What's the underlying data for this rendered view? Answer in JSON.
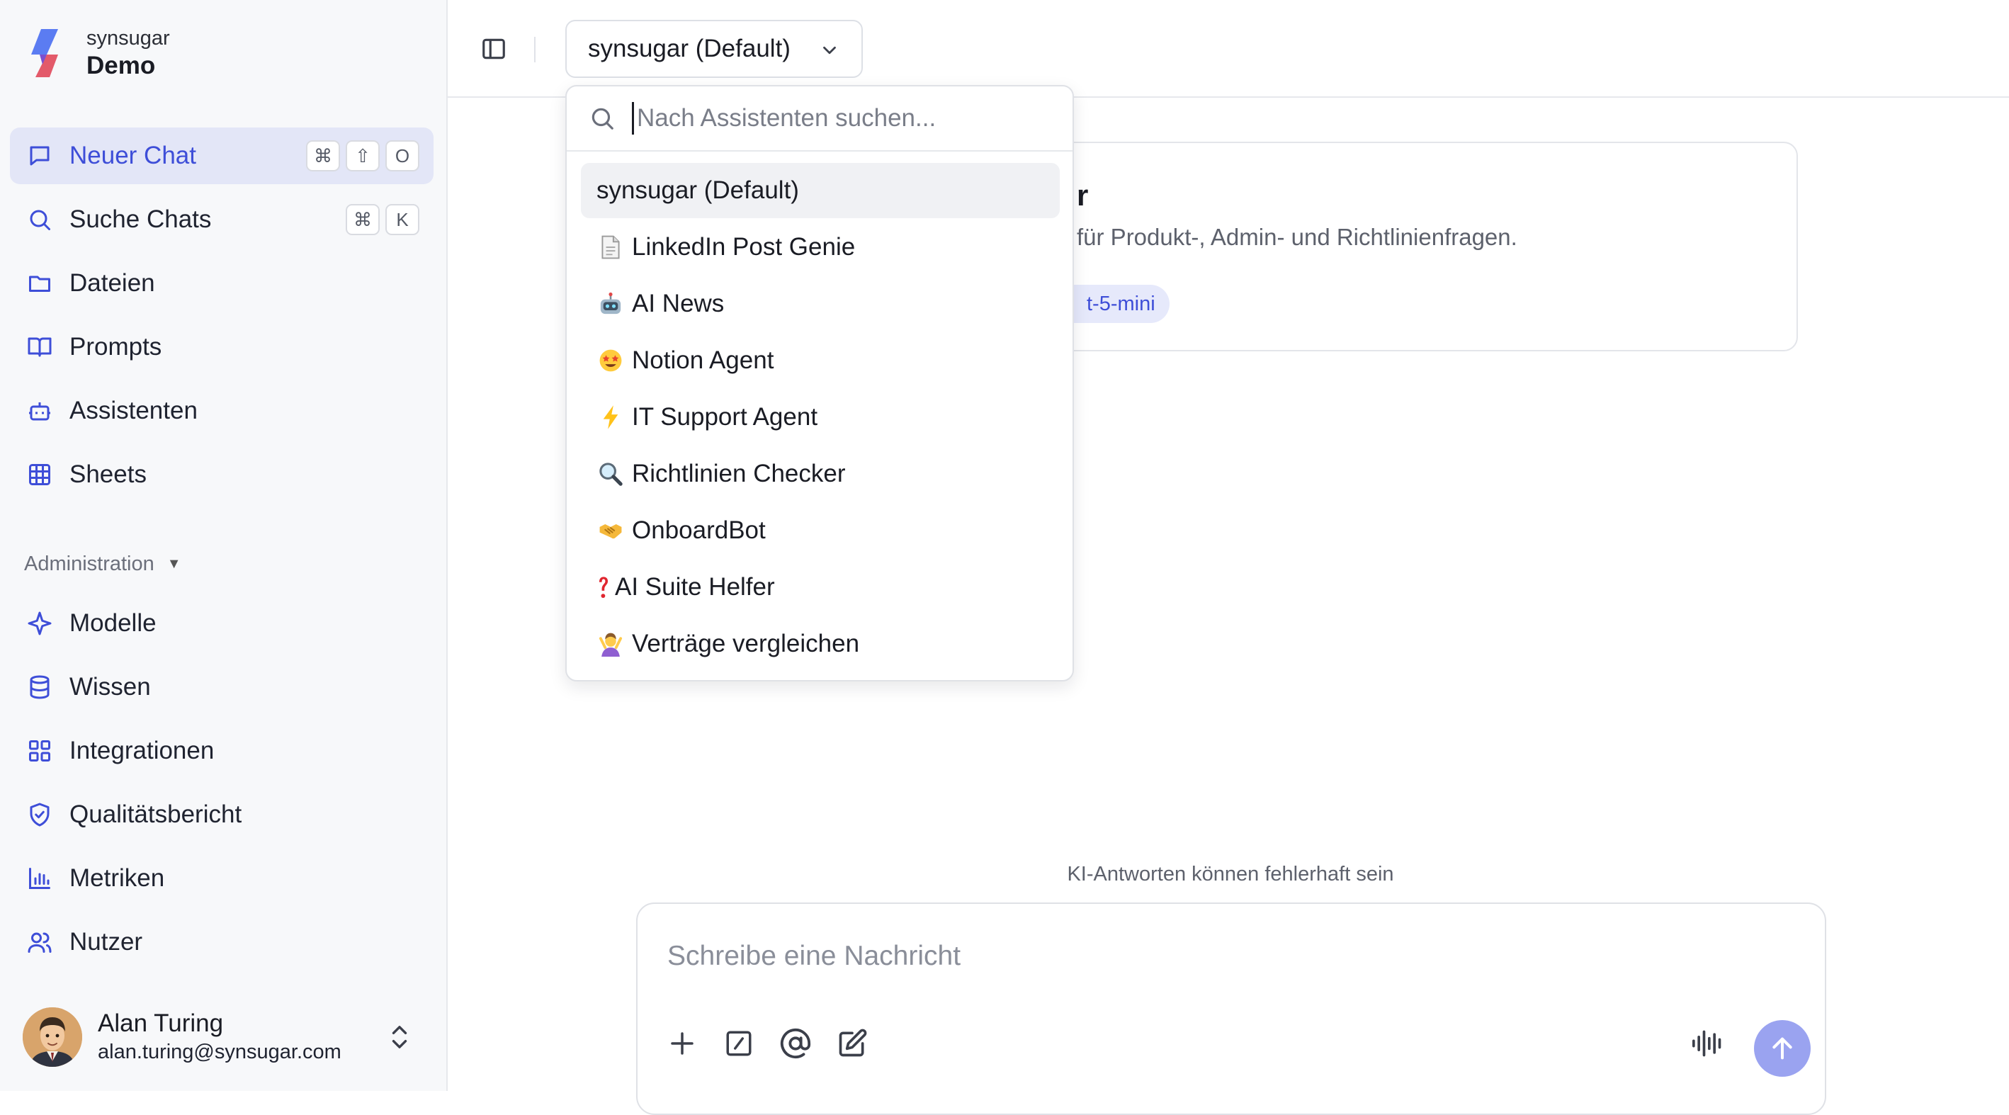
{
  "brand": {
    "org": "synsugar",
    "workspace": "Demo",
    "logo_icon": "synsugar-logo"
  },
  "sidebar": {
    "items": [
      {
        "label": "Neuer Chat",
        "icon": "chat-bubble-icon",
        "shortcut": [
          "⌘",
          "⇧",
          "O"
        ],
        "active": true
      },
      {
        "label": "Suche Chats",
        "icon": "search-icon",
        "shortcut": [
          "⌘",
          "K"
        ]
      },
      {
        "label": "Dateien",
        "icon": "folder-icon"
      },
      {
        "label": "Prompts",
        "icon": "book-icon"
      },
      {
        "label": "Assistenten",
        "icon": "bot-icon"
      },
      {
        "label": "Sheets",
        "icon": "table-icon"
      }
    ],
    "admin_label": "Administration",
    "admin_items": [
      {
        "label": "Modelle",
        "icon": "sparkle-icon"
      },
      {
        "label": "Wissen",
        "icon": "database-icon"
      },
      {
        "label": "Integrationen",
        "icon": "grid-icon"
      },
      {
        "label": "Qualitätsbericht",
        "icon": "shield-check-icon"
      },
      {
        "label": "Metriken",
        "icon": "bar-chart-icon"
      },
      {
        "label": "Nutzer",
        "icon": "users-icon"
      }
    ]
  },
  "user": {
    "name": "Alan Turing",
    "email": "alan.turing@synsugar.com"
  },
  "topbar": {
    "assistant_selected": "synsugar (Default)"
  },
  "dropdown": {
    "search_placeholder": "Nach Assistenten suchen...",
    "items": [
      {
        "emoji": "",
        "label": "synsugar (Default)",
        "selected": true
      },
      {
        "emoji": "📄",
        "label": "LinkedIn Post Genie"
      },
      {
        "emoji": "🤖",
        "label": "AI News"
      },
      {
        "emoji": "🤩",
        "label": "Notion Agent"
      },
      {
        "emoji": "⚡",
        "label": "IT Support Agent"
      },
      {
        "emoji": "🔍",
        "label": "Richtlinien Checker"
      },
      {
        "emoji": "🤝",
        "label": "OnboardBot"
      },
      {
        "emoji": "❓",
        "label": "AI Suite Helfer"
      },
      {
        "emoji": "🙆",
        "label": "Verträge vergleichen"
      }
    ]
  },
  "card": {
    "title_partial": "r",
    "description_partial": "für Produkt-, Admin- und Richtlinienfragen.",
    "badge_partial": "t-5-mini"
  },
  "composer": {
    "disclaimer": "KI-Antworten können fehlerhaft sein",
    "placeholder": "Schreibe eine Nachricht",
    "tools": [
      "plus-icon",
      "slash-command-icon",
      "at-mention-icon",
      "edit-icon"
    ],
    "voice_icon": "audio-waveform-icon",
    "send_icon": "arrow-up-icon"
  },
  "colors": {
    "accent": "#3e4ed8",
    "active_bg": "#e3e6f7",
    "send_bg": "#9aa3f0"
  }
}
